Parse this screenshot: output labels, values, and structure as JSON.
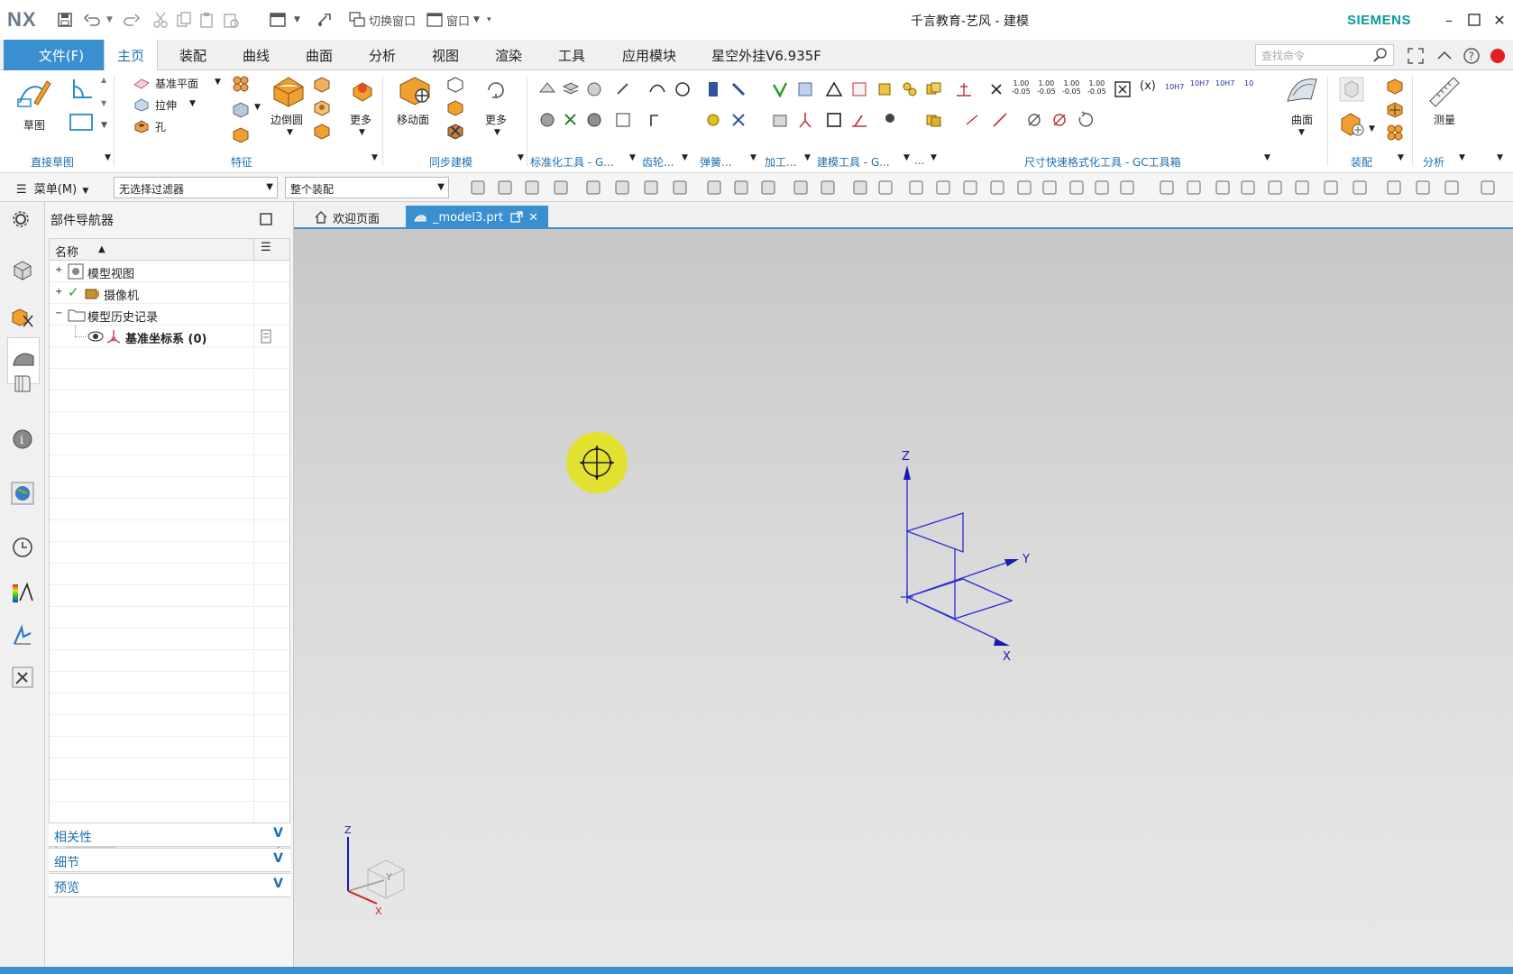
{
  "titlebar": {
    "logo": "NX",
    "switch_window": "切换窗口",
    "window": "窗口",
    "title": "千言教育-艺风 - 建模",
    "brand": "SIEMENS"
  },
  "tabs": {
    "file": "文件(F)",
    "items": [
      "主页",
      "装配",
      "曲线",
      "曲面",
      "分析",
      "视图",
      "渲染",
      "工具",
      "应用模块",
      "星空外挂V6.935F"
    ],
    "active": "主页",
    "search_placeholder": "查找命令"
  },
  "ribbon": {
    "sketch_label": "草图",
    "datum_plane": "基准平面",
    "extrude": "拉伸",
    "hole": "孔",
    "edge_blend": "边倒圆",
    "more1": "更多",
    "move_face": "移动面",
    "more2": "更多",
    "surface": "曲面",
    "measure": "测量",
    "groups": {
      "direct_sketch": "直接草图",
      "feature": "特征",
      "sync_modeling": "同步建模",
      "std_tools": "标准化工具 - G...",
      "gear": "齿轮...",
      "spring": "弹簧...",
      "machining": "加工...",
      "modeling_tools": "建模工具 - G...",
      "more_short": "...",
      "dim_format": "尺寸快速格式化工具 - GC工具箱",
      "assembly": "装配",
      "analysis": "分析"
    },
    "dim_labels": [
      "1.00",
      "1.00",
      "1.00",
      "1.00",
      "10H7",
      "10H7",
      "10H7",
      "10"
    ]
  },
  "toolbar2": {
    "menu": "菜单(M)",
    "filter": "无选择过滤器",
    "scope": "整个装配"
  },
  "navigator": {
    "title": "部件导航器",
    "column_name": "名称",
    "items": [
      {
        "label": "模型视图"
      },
      {
        "label": "摄像机"
      },
      {
        "label": "模型历史记录"
      },
      {
        "label": "基准坐标系 (0)"
      }
    ],
    "sections": [
      "相关性",
      "细节",
      "预览"
    ]
  },
  "doc_tabs": {
    "welcome": "欢迎页面",
    "model": "_model3.prt"
  },
  "viewport": {
    "axis_z": "Z",
    "axis_y": "Y",
    "axis_x": "X"
  },
  "colors": {
    "accent": "#3a8fd0",
    "brand": "#0a9a9a",
    "csys": "#2b2bd6",
    "cursor": "#e4e21e"
  }
}
